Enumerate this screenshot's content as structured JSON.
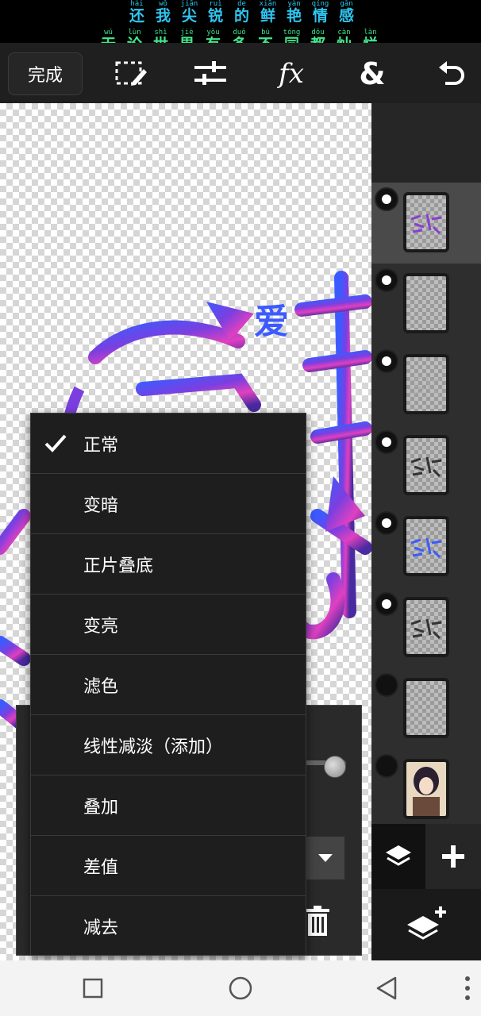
{
  "lyrics": {
    "line1": [
      {
        "py": "hái",
        "hz": "还"
      },
      {
        "py": "wǒ",
        "hz": "我"
      },
      {
        "py": "jiān",
        "hz": "尖"
      },
      {
        "py": "ruì",
        "hz": "锐"
      },
      {
        "py": "de",
        "hz": "的"
      },
      {
        "py": "xiān",
        "hz": "鲜"
      },
      {
        "py": "yàn",
        "hz": "艳"
      },
      {
        "py": "qíng",
        "hz": "情"
      },
      {
        "py": "gǎn",
        "hz": "感"
      }
    ],
    "line2": [
      {
        "py": "wú",
        "hz": "无"
      },
      {
        "py": "lùn",
        "hz": "论"
      },
      {
        "py": "shì",
        "hz": "世"
      },
      {
        "py": "jiè",
        "hz": "界"
      },
      {
        "py": "yǒu",
        "hz": "有"
      },
      {
        "py": "duō",
        "hz": "多"
      },
      {
        "py": "bù",
        "hz": "不"
      },
      {
        "py": "tóng",
        "hz": "同"
      },
      {
        "py": "dōu",
        "hz": "都"
      },
      {
        "py": "càn",
        "hz": "灿"
      },
      {
        "py": "làn",
        "hz": "烂"
      }
    ]
  },
  "toolbar": {
    "done_label": "完成",
    "icons": [
      "selection-edit-icon",
      "adjust-sliders-icon",
      "fx-icon",
      "ampersand-icon",
      "undo-icon"
    ]
  },
  "blend_menu": {
    "selected_index": 0,
    "items": [
      "正常",
      "变暗",
      "正片叠底",
      "变亮",
      "滤色",
      "线性减淡（添加）",
      "叠加",
      "差值",
      "减去"
    ]
  },
  "layers": {
    "rows": [
      {
        "visible": true,
        "selected": true,
        "thumb": "artwork-small"
      },
      {
        "visible": true,
        "selected": false,
        "thumb": "empty"
      },
      {
        "visible": true,
        "selected": false,
        "thumb": "faint"
      },
      {
        "visible": true,
        "selected": false,
        "thumb": "dark-text"
      },
      {
        "visible": true,
        "selected": false,
        "thumb": "blue-text"
      },
      {
        "visible": true,
        "selected": false,
        "thumb": "dark-text"
      },
      {
        "visible": false,
        "selected": false,
        "thumb": "empty"
      },
      {
        "visible": false,
        "selected": false,
        "thumb": "photo"
      }
    ]
  },
  "colors": {
    "accent_blue": "#2fc6f0",
    "accent_green": "#44e58a",
    "art_purple": "#7b3fe0",
    "art_blue": "#3c5bff",
    "art_pink": "#e040c0"
  }
}
